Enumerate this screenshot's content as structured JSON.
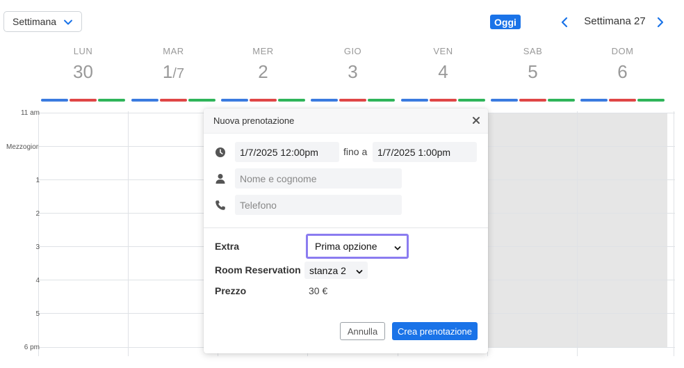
{
  "toolbar": {
    "view_label": "Settimana",
    "today_label": "Oggi",
    "week_label": "Settimana 27"
  },
  "days": [
    {
      "name": "LUN",
      "num": "30",
      "num_suffix": ""
    },
    {
      "name": "MAR",
      "num": "1",
      "num_suffix": "/7"
    },
    {
      "name": "MER",
      "num": "2",
      "num_suffix": ""
    },
    {
      "name": "GIO",
      "num": "3",
      "num_suffix": ""
    },
    {
      "name": "VEN",
      "num": "4",
      "num_suffix": ""
    },
    {
      "name": "SAB",
      "num": "5",
      "num_suffix": ""
    },
    {
      "name": "DOM",
      "num": "6",
      "num_suffix": ""
    }
  ],
  "time_labels": [
    "11 am",
    "Mezzogiorno",
    "1",
    "2",
    "3",
    "4",
    "5",
    "6 pm"
  ],
  "colors": {
    "bar_blue": "#3b7be0",
    "bar_red": "#e04646",
    "bar_green": "#2fb55a",
    "accent": "#1a73e8",
    "focus_ring": "#8b7cf0"
  },
  "modal": {
    "title": "Nuova prenotazione",
    "start_value": "1/7/2025 12:00pm",
    "until_label": "fino a",
    "end_value": "1/7/2025 1:00pm",
    "name_placeholder": "Nome e cognome",
    "phone_placeholder": "Telefono",
    "extra_label": "Extra",
    "extra_value": "Prima opzione",
    "room_label": "Room Reservation",
    "room_value": "stanza 2",
    "price_label": "Prezzo",
    "price_value": "30 €",
    "cancel_label": "Annulla",
    "create_label": "Crea prenotazione"
  },
  "icons": {
    "close": "close-icon",
    "clock": "clock-icon",
    "person": "person-icon",
    "phone": "phone-icon"
  }
}
